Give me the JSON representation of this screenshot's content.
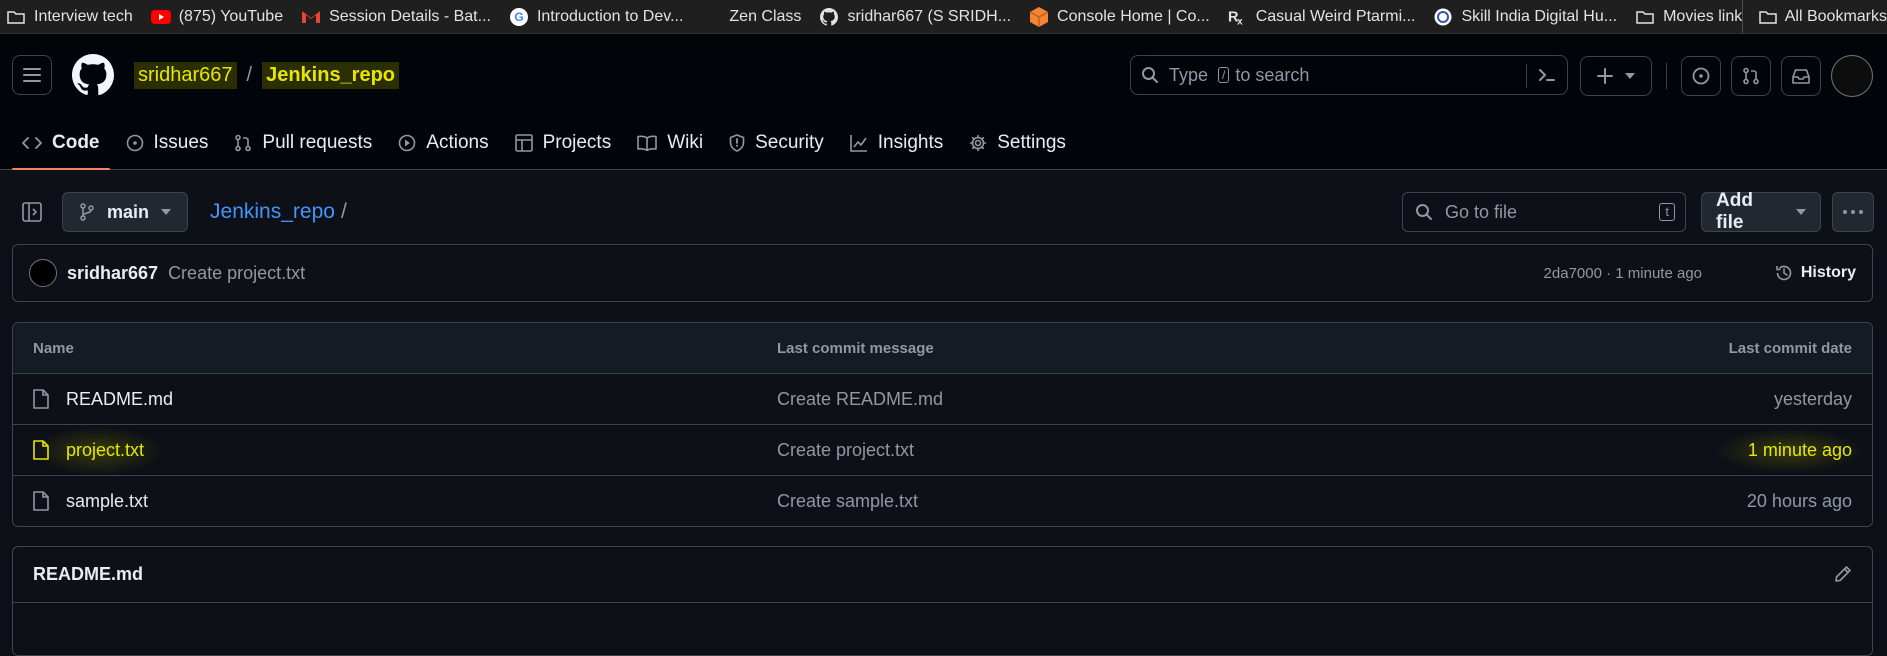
{
  "bookmarks": [
    {
      "label": "Interview tech",
      "icon": "folder-icon"
    },
    {
      "label": "(875) YouTube",
      "icon": "youtube-icon"
    },
    {
      "label": "Session Details - Bat...",
      "icon": "gmail-icon"
    },
    {
      "label": "Introduction to Dev...",
      "icon": "google-icon"
    },
    {
      "label": "Zen Class",
      "icon": "blank-icon"
    },
    {
      "label": "sridhar667 (S SRIDH...",
      "icon": "github-icon"
    },
    {
      "label": "Console Home | Co...",
      "icon": "aws-icon"
    },
    {
      "label": "Casual Weird Ptarmi...",
      "icon": "rx-icon"
    },
    {
      "label": "Skill India Digital Hu...",
      "icon": "skill-india-icon"
    },
    {
      "label": "Movies link",
      "icon": "folder-icon"
    }
  ],
  "bookmarks_right": {
    "label": "All Bookmarks",
    "icon": "folder-icon"
  },
  "header": {
    "owner": "sridhar667",
    "separator": "/",
    "repo": "Jenkins_repo",
    "search_placeholder_pre": "Type",
    "search_key": "/",
    "search_placeholder_post": "to search"
  },
  "tabs": [
    {
      "label": "Code",
      "icon": "code-icon",
      "active": true
    },
    {
      "label": "Issues",
      "icon": "issue-icon"
    },
    {
      "label": "Pull requests",
      "icon": "pull-request-icon"
    },
    {
      "label": "Actions",
      "icon": "play-icon"
    },
    {
      "label": "Projects",
      "icon": "table-icon"
    },
    {
      "label": "Wiki",
      "icon": "book-icon"
    },
    {
      "label": "Security",
      "icon": "shield-icon"
    },
    {
      "label": "Insights",
      "icon": "graph-icon"
    },
    {
      "label": "Settings",
      "icon": "gear-icon"
    }
  ],
  "toolbar": {
    "branch": "main",
    "repo_crumb": "Jenkins_repo",
    "crumb_slash": "/",
    "goto_placeholder": "Go to file",
    "goto_key": "t",
    "add_file": "Add file"
  },
  "commit": {
    "author": "sridhar667",
    "message": "Create project.txt",
    "meta": "2da7000 · 1 minute ago",
    "history": "History"
  },
  "files": {
    "headers": {
      "name": "Name",
      "message": "Last commit message",
      "date": "Last commit date"
    },
    "rows": [
      {
        "name": "README.md",
        "message": "Create README.md",
        "date": "yesterday"
      },
      {
        "name": "project.txt",
        "message": "Create project.txt",
        "date": "1 minute ago",
        "highlighted": true
      },
      {
        "name": "sample.txt",
        "message": "Create sample.txt",
        "date": "20 hours ago"
      }
    ]
  },
  "readme": {
    "title": "README.md"
  },
  "colors": {
    "accent_tab": "#f78166",
    "link": "#4493f8",
    "highlight": "#e6e600",
    "bg": "#0d1117",
    "border": "#3d444d"
  }
}
